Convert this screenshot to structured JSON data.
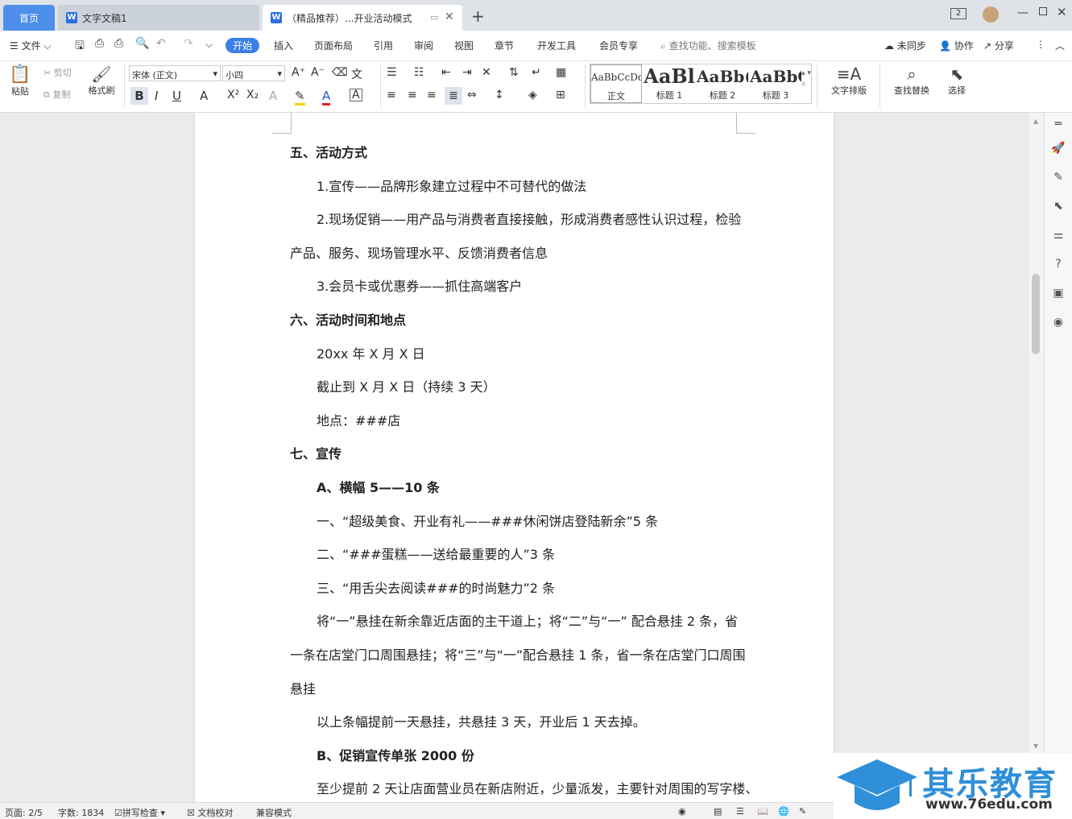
{
  "tabs": {
    "home": "首页",
    "doc1": "文字文稿1",
    "doc2": "（精品推荐）...开业活动模式"
  },
  "window": {
    "badge": "2"
  },
  "menu": {
    "file": "文件",
    "start": "开始",
    "insert": "插入",
    "layout": "页面布局",
    "reference": "引用",
    "review": "审阅",
    "view": "视图",
    "chapter": "章节",
    "dev": "开发工具",
    "member": "会员专享",
    "search_placeholder": "查找功能、搜索模板",
    "unsynced": "未同步",
    "collab": "协作",
    "share": "分享"
  },
  "ribbon": {
    "paste": "粘贴",
    "cut": "剪切",
    "copy": "复制",
    "format_painter": "格式刷",
    "font": "宋体 (正文)",
    "size": "小四",
    "styles": [
      {
        "preview": "AaBbCcDd",
        "label": "正文"
      },
      {
        "preview": "AaBl",
        "label": "标题 1"
      },
      {
        "preview": "AaBb(",
        "label": "标题 2"
      },
      {
        "preview": "AaBbC",
        "label": "标题 3"
      }
    ],
    "text_layout": "文字排版",
    "find_replace": "查找替换",
    "select": "选择"
  },
  "document": {
    "paragraphs": [
      "五、活动方式",
      "1.宣传——品牌形象建立过程中不可替代的做法",
      "2.现场促销——用产品与消费者直接接触，形成消费者感性认识过程，检验",
      "产品、服务、现场管理水平、反馈消费者信息",
      "3.会员卡或优惠券——抓住高端客户",
      "六、活动时间和地点",
      "20xx 年 X 月 X 日",
      "截止到 X 月 X 日（持续 3 天）",
      "地点：###店",
      "七、宣传",
      "A、横幅 5——10 条",
      "一、“超级美食、开业有礼——###休闲饼店登陆新余”5 条",
      "二、“###蛋糕——送给最重要的人”3 条",
      "三、“用舌尖去阅读###的时尚魅力”2 条",
      "将“一”悬挂在新余靠近店面的主干道上；将“二”与“一” 配合悬挂 2 条，省",
      "一条在店堂门口周围悬挂；将“三”与“一”配合悬挂 1 条，省一条在店堂门口周围",
      "悬挂",
      "以上条幅提前一天悬挂，共悬挂 3 天，开业后 1 天去掉。",
      "B、促销宣传单张 2000 份",
      "至少提前 2 天让店面营业员在新店附近，少量派发，主要针对周围的写字楼、"
    ]
  },
  "status": {
    "page": "页面: 2/5",
    "words": "字数: 1834",
    "spell": "拼写检查",
    "proof": "文档校对",
    "compat": "兼容模式"
  },
  "watermark": {
    "name": "其乐教育",
    "url": "www.76edu.com"
  }
}
